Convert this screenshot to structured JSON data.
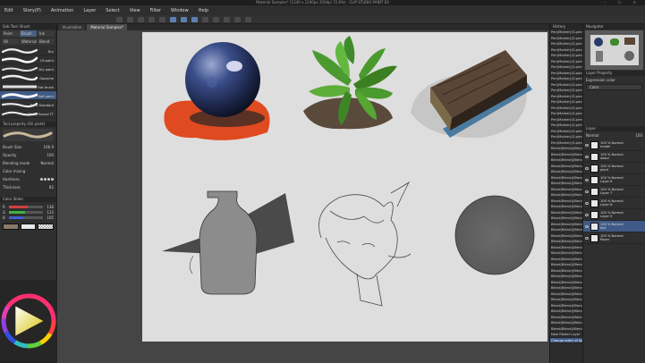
{
  "window": {
    "title": "Material Samples* (1240 x 1240px 350dpi 72.6%) - CLIP STUDIO PAINT EX"
  },
  "menu": [
    "Edit",
    "Story(P)",
    "Animation",
    "Layer",
    "Select",
    "View",
    "Filter",
    "Window",
    "Help"
  ],
  "canvas_tabs": [
    "Illustration",
    "Material Samples*"
  ],
  "tool_panel": {
    "title": "Sub Tool: Brush",
    "tabs": [
      "Paint",
      "Brush",
      "Ink",
      "Oil",
      "Watercolor",
      "Blend"
    ],
    "brushes": [
      {
        "label": "Dry"
      },
      {
        "label": "Oil paint"
      },
      {
        "label": "Dry paint"
      },
      {
        "label": "Gouache"
      },
      {
        "label": "Flat brush"
      },
      {
        "label": "Soft paint"
      },
      {
        "label": "Paint Standard"
      },
      {
        "label": "Mixed Round TT"
      }
    ]
  },
  "tool_property": {
    "title": "Tool property (Oil paint)",
    "rows": [
      {
        "label": "Brush Size",
        "value": "166.9"
      },
      {
        "label": "Opacity",
        "value": "100"
      },
      {
        "label": "Blending mode",
        "value": "Normal"
      },
      {
        "label": "Color mixing",
        "value": ""
      },
      {
        "label": "Hardness",
        "value": ""
      },
      {
        "label": "Thickness",
        "value": "82"
      }
    ]
  },
  "color_slider": {
    "title": "Color Slider",
    "rows": [
      {
        "label": "R",
        "value": "138",
        "fill": 0.54,
        "color": "#d04040"
      },
      {
        "label": "G",
        "value": "122",
        "fill": 0.48,
        "color": "#40b040"
      },
      {
        "label": "B",
        "value": "105",
        "fill": 0.41,
        "color": "#4060d0"
      }
    ]
  },
  "history": {
    "title": "History",
    "items": [
      "Pen(Marker)(G-pen)",
      "Pen(Marker)(G-pen)",
      "Pen(Marker)(G-pen)",
      "Pen(Marker)(G-pen)",
      "Pen(Marker)(G-pen)",
      "Pen(Marker)(G-pen)",
      "Pen(Marker)(G-pen)",
      "Pen(Marker)(G-pen)",
      "Pen(Marker)(G-pen)",
      "Pen(Marker)(G-pen)",
      "Pen(Marker)(G-pen)",
      "Pen(Marker)(G-pen)",
      "Pen(Marker)(G-pen)",
      "Pen(Marker)(G-pen)",
      "Pen(Marker)(G-pen)",
      "Pen(Marker)(G-pen)",
      "Pen(Marker)(G-pen)",
      "Pen(Marker)(G-pen)",
      "Pen(Marker)(G-pen)",
      "Pen(Marker)(G-pen)",
      "Blend(Blend)(Blend)",
      "Blend(Blend)(Blend)",
      "Blend(Blend)(Blend)",
      "Blend(Blend)(Blend)",
      "Blend(Blend)(Blend)",
      "Blend(Blend)(Blend)",
      "Blend(Blend)(Blend)",
      "Blend(Blend)(Blend)",
      "Blend(Blend)(Blend)",
      "Blend(Blend)(Blend)",
      "Blend(Blend)(Blend)",
      "Blend(Blend)(Blend)",
      "Blend(Blend)(Blend)",
      "Blend(Blend)(Blend)",
      "Blend(Blend)(Blend)",
      "Blend(Blend)(Blend)",
      "Blend(Blend)(Blend)",
      "Blend(Blend)(Blend)",
      "Blend(Blend)(Blend)",
      "Blend(Blend)(Blend)",
      "Blend(Blend)(Blend)",
      "Blend(Blend)(Blend)",
      "Blend(Blend)(Blend)",
      "Blend(Blend)(Blend)",
      "Blend(Blend)(Blend)",
      "Blend(Blend)(Blend)",
      "Blend(Blend)(Blend)",
      "Blend(Blend)(Blend)",
      "Blend(Blend)(Blend)",
      "Blend(Blend)(Blend)",
      "Blend(Blend)(Blend)",
      "Blend(Blend)(Blend)",
      "New Raster Layer",
      "Change order of layer"
    ],
    "selected_index": 53
  },
  "navigator": {
    "title": "Navigator"
  },
  "layer_property": {
    "title": "Layer Property",
    "expression_label": "Expression color",
    "expression_value": "Color"
  },
  "layers": {
    "title": "Layer",
    "blend_mode": "Normal",
    "opacity": "100",
    "items": [
      {
        "name": "100 % Normal",
        "sub": "model"
      },
      {
        "name": "100 % Normal",
        "sub": "wood"
      },
      {
        "name": "100 % Normal",
        "sub": "plant"
      },
      {
        "name": "100 % Normal",
        "sub": "Layer 8"
      },
      {
        "name": "100 % Normal",
        "sub": "Layer 7"
      },
      {
        "name": "100 % Normal",
        "sub": "Layer 6"
      },
      {
        "name": "100 % Normal",
        "sub": "Layer 5"
      },
      {
        "name": "100 % Normal",
        "sub": "ball"
      },
      {
        "name": "100 % Normal",
        "sub": "Paper"
      }
    ],
    "selected_index": 7
  }
}
